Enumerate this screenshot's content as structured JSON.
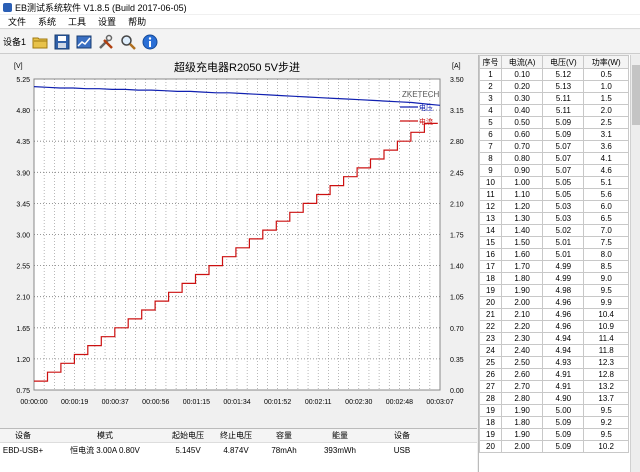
{
  "window": {
    "title": "EB测试系统软件 V1.8.5 (Build 2017-06-05)"
  },
  "menu": {
    "items": [
      "文件",
      "系统",
      "工具",
      "设置",
      "帮助"
    ]
  },
  "toolbar": {
    "device_label": "设备1",
    "icons": [
      "open-folder-icon",
      "save-disk-icon",
      "chart-view-icon",
      "tools-icon",
      "zoom-icon",
      "info-icon"
    ]
  },
  "chart_data": {
    "type": "line",
    "title": "超级充电器R2050 5V步进",
    "watermark": "ZKETECH",
    "left_axis_unit": "[V]",
    "right_axis_unit": "[A]",
    "yticks_left": [
      "5.25",
      "4.80",
      "4.35",
      "3.90",
      "3.45",
      "3.00",
      "2.55",
      "2.10",
      "1.65",
      "1.20",
      "0.75"
    ],
    "yticks_right": [
      "3.50",
      "3.15",
      "2.80",
      "2.45",
      "2.10",
      "1.75",
      "1.40",
      "1.05",
      "0.70",
      "0.35",
      "0.00"
    ],
    "xticks": [
      "00:00:00",
      "00:00:19",
      "00:00:37",
      "00:00:56",
      "00:01:15",
      "00:01:34",
      "00:01:52",
      "00:02:11",
      "00:02:30",
      "00:02:48",
      "00:03:07"
    ],
    "ylim_left": [
      0.75,
      5.25
    ],
    "ylim_right": [
      0.0,
      3.5
    ],
    "xlim": [
      0,
      187
    ],
    "grid": true,
    "series": [
      {
        "name": "电压",
        "axis": "left",
        "color": "#1020b0",
        "x": [
          0,
          6,
          12,
          18,
          24,
          30,
          36,
          42,
          48,
          54,
          60,
          66,
          72,
          78,
          84,
          90,
          96,
          102,
          108,
          114,
          120,
          126,
          132,
          138,
          144,
          150,
          156,
          162,
          168,
          174,
          180,
          187
        ],
        "values": [
          5.14,
          5.13,
          5.12,
          5.12,
          5.11,
          5.11,
          5.1,
          5.1,
          5.09,
          5.09,
          5.08,
          5.07,
          5.07,
          5.06,
          5.05,
          5.05,
          5.04,
          5.03,
          5.02,
          5.01,
          5.0,
          4.99,
          4.98,
          4.97,
          4.96,
          4.95,
          4.94,
          4.93,
          4.92,
          4.91,
          4.89,
          4.87
        ]
      },
      {
        "name": "电流",
        "axis": "right",
        "color": "#cc1010",
        "step_start": 0.1,
        "step_size": 0.1,
        "step_count": 30,
        "step_duration": 6.2
      }
    ]
  },
  "table": {
    "headers": [
      "序号",
      "电流(A)",
      "电压(V)",
      "功率(W)"
    ],
    "rows": [
      [
        "1",
        "0.10",
        "5.12",
        "0.5"
      ],
      [
        "2",
        "0.20",
        "5.13",
        "1.0"
      ],
      [
        "3",
        "0.30",
        "5.11",
        "1.5"
      ],
      [
        "4",
        "0.40",
        "5.11",
        "2.0"
      ],
      [
        "5",
        "0.50",
        "5.09",
        "2.5"
      ],
      [
        "6",
        "0.60",
        "5.09",
        "3.1"
      ],
      [
        "7",
        "0.70",
        "5.07",
        "3.6"
      ],
      [
        "8",
        "0.80",
        "5.07",
        "4.1"
      ],
      [
        "9",
        "0.90",
        "5.07",
        "4.6"
      ],
      [
        "10",
        "1.00",
        "5.05",
        "5.1"
      ],
      [
        "11",
        "1.10",
        "5.05",
        "5.6"
      ],
      [
        "12",
        "1.20",
        "5.03",
        "6.0"
      ],
      [
        "13",
        "1.30",
        "5.03",
        "6.5"
      ],
      [
        "14",
        "1.40",
        "5.02",
        "7.0"
      ],
      [
        "15",
        "1.50",
        "5.01",
        "7.5"
      ],
      [
        "16",
        "1.60",
        "5.01",
        "8.0"
      ],
      [
        "17",
        "1.70",
        "4.99",
        "8.5"
      ],
      [
        "18",
        "1.80",
        "4.99",
        "9.0"
      ],
      [
        "19",
        "1.90",
        "4.98",
        "9.5"
      ],
      [
        "20",
        "2.00",
        "4.96",
        "9.9"
      ],
      [
        "21",
        "2.10",
        "4.96",
        "10.4"
      ],
      [
        "22",
        "2.20",
        "4.96",
        "10.9"
      ],
      [
        "23",
        "2.30",
        "4.94",
        "11.4"
      ],
      [
        "24",
        "2.40",
        "4.94",
        "11.8"
      ],
      [
        "25",
        "2.50",
        "4.93",
        "12.3"
      ],
      [
        "26",
        "2.60",
        "4.91",
        "12.8"
      ],
      [
        "27",
        "2.70",
        "4.91",
        "13.2"
      ],
      [
        "28",
        "2.80",
        "4.90",
        "13.7"
      ],
      [
        "19",
        "1.90",
        "5.00",
        "9.5"
      ],
      [
        "18",
        "1.80",
        "5.09",
        "9.2"
      ],
      [
        "19",
        "1.90",
        "5.09",
        "9.5"
      ],
      [
        "20",
        "2.00",
        "5.09",
        "10.2"
      ]
    ]
  },
  "status": {
    "headers": [
      "设备",
      "模式",
      "起始电压",
      "终止电压",
      "容量",
      "能量",
      "设备"
    ],
    "values": [
      "EBD-USB+",
      "恒电流 3.00A 0.80V",
      "5.145V",
      "4.874V",
      "78mAh",
      "393mWh",
      "USB"
    ]
  }
}
